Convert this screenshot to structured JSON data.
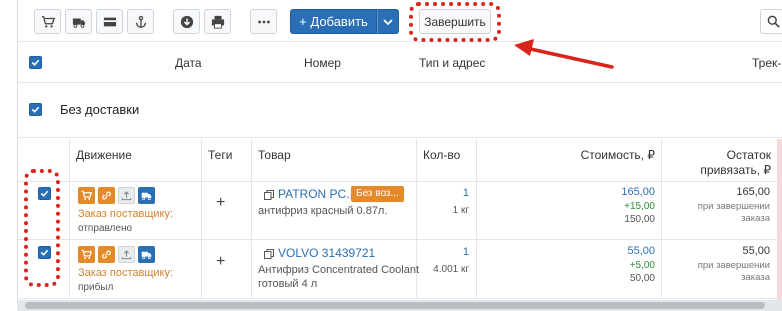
{
  "toolbar": {
    "icons": [
      "cart-icon",
      "truck-icon",
      "card-icon",
      "anchor-icon",
      "download-icon",
      "print-icon",
      "more-icon"
    ],
    "add_label": "+ Добавить",
    "finish_label": "Завершить"
  },
  "header": {
    "date": "Дата",
    "number": "Номер",
    "type_address": "Тип и адрес",
    "track": "Трек-"
  },
  "group": {
    "title": "Без доставки"
  },
  "table": {
    "columns": {
      "movement": "Движение",
      "tags": "Теги",
      "product": "Товар",
      "qty": "Кол-во",
      "cost": "Стоимость, ₽",
      "rest": "Остаток\nпривязать, ₽"
    },
    "rows": [
      {
        "move_label": "Заказ поставщику:",
        "move_status": "отправлено",
        "tag_add": "+",
        "product_name": "PATRON PC...",
        "product_badge": "Без воз...",
        "product_desc": "антифриз красный 0.87л.",
        "qty": "1",
        "unit": "1 кг",
        "cost": "165,00",
        "cost_add": "+15,00",
        "cost_base": "150,00",
        "rest": "165,00",
        "rest_note": "при завершении\nзаказа"
      },
      {
        "move_label": "Заказ поставщику:",
        "move_status": "прибыл",
        "tag_add": "+",
        "product_name": "VOLVO 31439721",
        "product_badge": "",
        "product_desc": "Антифриз Concentrated Coolant готовый 4 л",
        "qty": "1",
        "unit": "4.001 кг",
        "cost": "55,00",
        "cost_add": "+5,00",
        "cost_base": "50,00",
        "rest": "55,00",
        "rest_note": "при завершении\nзаказа"
      }
    ]
  },
  "colors": {
    "primary": "#2a6fb5",
    "accent_orange": "#e58a28",
    "highlight_red": "#d9241c",
    "positive_green": "#2e8b3a"
  }
}
